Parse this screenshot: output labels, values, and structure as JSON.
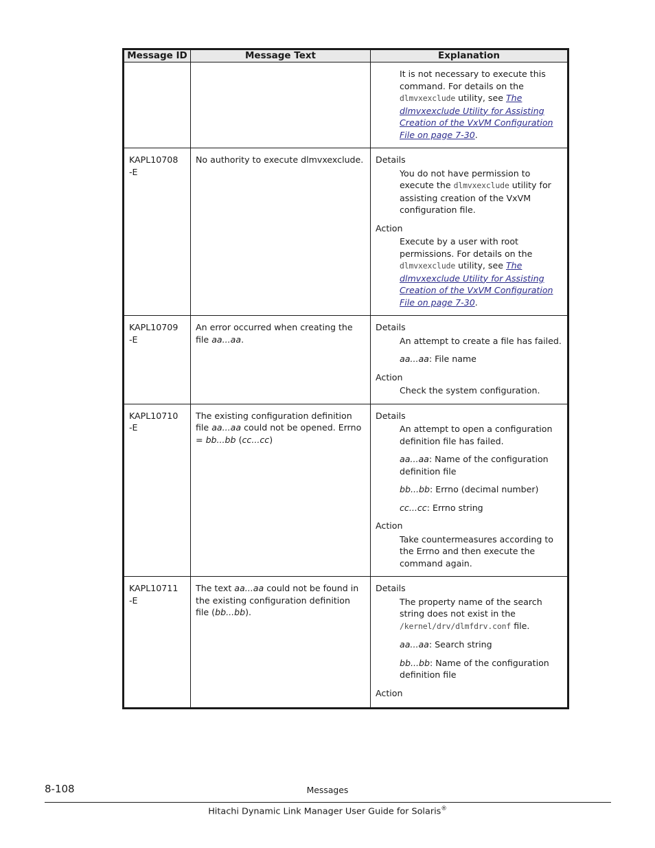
{
  "table": {
    "headers": {
      "message_id": "Message\nID",
      "message_text": "Message Text",
      "explanation": "Explanation"
    },
    "rows": [
      {
        "id": "",
        "text": "",
        "explanation": {
          "continued_paragraph": {
            "part1": "It is not necessary to execute this command. For details on the ",
            "code1": "dlmvxexclude",
            "part2": " utility, see ",
            "link": "The dlmvxexclude Utility for Assisting Creation of the VxVM Configuration File on page 7-30",
            "part3": "."
          }
        }
      },
      {
        "id": "KAPL10708\n-E",
        "text": "No authority to execute dlmvxexclude.",
        "explanation": {
          "details_label": "Details",
          "details_body": {
            "part1": "You do not have permission to execute the ",
            "code1": "dlmvxexclude",
            "part2": " utility for assisting creation of the VxVM configuration file."
          },
          "action_label": "Action",
          "action_body": {
            "part1": "Execute by a user with root permissions. For details on the ",
            "code1": "dlmvxexclude",
            "part2": " utility, see ",
            "link": "The dlmvxexclude Utility for Assisting Creation of the VxVM Configuration File on page 7-30",
            "part3": "."
          }
        }
      },
      {
        "id": "KAPL10709\n-E",
        "text": {
          "part1": "An error occurred when creating the file ",
          "var1": "aa...aa",
          "part2": "."
        },
        "explanation": {
          "details_label": "Details",
          "details_body": "An attempt to create a file has failed.",
          "details_var": {
            "var1": "aa...aa",
            "desc1": ": File name"
          },
          "action_label": "Action",
          "action_body": "Check the system configuration."
        }
      },
      {
        "id": "KAPL10710\n-E",
        "text": {
          "part1": "The existing configuration definition file ",
          "var1": "aa...aa",
          "part2": " could not be opened. Errno = ",
          "var2": "bb...bb",
          "part3": " (",
          "var3": "cc...cc",
          "part4": ")"
        },
        "explanation": {
          "details_label": "Details",
          "details_body": "An attempt to open a configuration definition file has failed.",
          "details_vars": [
            {
              "var": "aa...aa",
              "desc": ": Name of the configuration definition file"
            },
            {
              "var": "bb...bb",
              "desc": ": Errno (decimal number)"
            },
            {
              "var": "cc...cc",
              "desc": ": Errno string"
            }
          ],
          "action_label": "Action",
          "action_body": "Take countermeasures according to the Errno and then execute the command again."
        }
      },
      {
        "id": "KAPL10711\n-E",
        "text": {
          "part1": "The text ",
          "var1": "aa...aa",
          "part2": " could not be found in the existing configuration definition file (",
          "var2": "bb...bb",
          "part3": ")."
        },
        "explanation": {
          "details_label": "Details",
          "details_body": {
            "part1": "The property name of the search string does not exist in the ",
            "code1": "/kernel/drv/dlmfdrv.conf",
            "part2": " file."
          },
          "details_vars": [
            {
              "var": "aa...aa",
              "desc": ": Search string"
            },
            {
              "var": "bb...bb",
              "desc": ": Name of the configuration definition file"
            }
          ],
          "action_label": "Action"
        }
      }
    ]
  },
  "footer": {
    "page_number": "8-108",
    "section_name": "Messages",
    "guide_title": "Hitachi Dynamic Link Manager User Guide for Solaris",
    "guide_title_mark": "®"
  }
}
